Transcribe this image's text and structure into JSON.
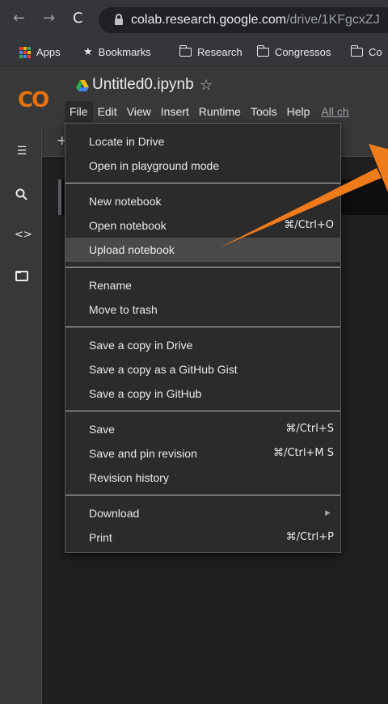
{
  "browser": {
    "url_host": "colab.research.google.com",
    "url_path": "/drive/1KFgcxZJ",
    "bookmarks": [
      {
        "label": "Apps",
        "icon": "apps-grid-icon"
      },
      {
        "label": "Bookmarks",
        "icon": "star-icon"
      },
      {
        "label": "Research",
        "icon": "folder-icon"
      },
      {
        "label": "Congressos",
        "icon": "folder-icon"
      },
      {
        "label": "Co",
        "icon": "folder-icon"
      }
    ]
  },
  "colab": {
    "logo": "CO",
    "notebook_title": "Untitled0.ipynb",
    "menu": [
      "File",
      "Edit",
      "View",
      "Insert",
      "Runtime",
      "Tools",
      "Help"
    ],
    "all_changes_link": "All ch"
  },
  "file_menu": {
    "items": [
      {
        "label": "Locate in Drive",
        "shortcut": ""
      },
      {
        "label": "Open in playground mode",
        "shortcut": ""
      },
      {
        "label": "New notebook",
        "shortcut": ""
      },
      {
        "label": "Open notebook",
        "shortcut": "⌘/Ctrl+O"
      },
      {
        "label": "Upload notebook",
        "shortcut": "",
        "highlighted": true
      },
      {
        "label": "Rename",
        "shortcut": ""
      },
      {
        "label": "Move to trash",
        "shortcut": ""
      },
      {
        "label": "Save a copy in Drive",
        "shortcut": ""
      },
      {
        "label": "Save a copy as a GitHub Gist",
        "shortcut": ""
      },
      {
        "label": "Save a copy in GitHub",
        "shortcut": ""
      },
      {
        "label": "Save",
        "shortcut": "⌘/Ctrl+S"
      },
      {
        "label": "Save and pin revision",
        "shortcut": "⌘/Ctrl+M S"
      },
      {
        "label": "Revision history",
        "shortcut": ""
      },
      {
        "label": "Download",
        "shortcut": "",
        "submenu": true
      },
      {
        "label": "Print",
        "shortcut": "⌘/Ctrl+P"
      }
    ]
  },
  "colors": {
    "annotation_arrow": "#f07b1b",
    "logo_yellow": "#f9ab00",
    "logo_orange": "#e8710a",
    "menu_bg": "#2b2b2b",
    "menu_highlight": "#494949"
  }
}
